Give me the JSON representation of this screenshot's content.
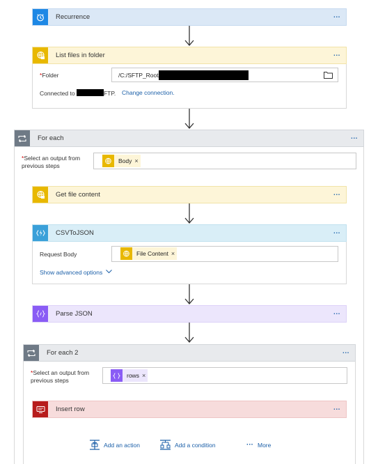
{
  "steps": {
    "recurrence": {
      "title": "Recurrence",
      "icon": "clock-icon",
      "color": "#1e88e5"
    },
    "list_files": {
      "title": "List files in folder",
      "icon": "sftp-icon",
      "color": "#e8b800",
      "folder_label": "Folder",
      "folder_value": "/C:/SFTP_Root/",
      "connected_prefix": "Connected to",
      "connected_suffix": "FTP.",
      "change_connection": "Change connection."
    },
    "for_each": {
      "title": "For each",
      "select_label_line1": "Select an output from",
      "select_label_line2": "previous steps",
      "token": "Body"
    },
    "get_file_content": {
      "title": "Get file content"
    },
    "csv_to_json": {
      "title": "CSVToJSON",
      "icon": "function-icon",
      "color": "#3aa0d9",
      "request_body_label": "Request Body",
      "token": "File Content",
      "advanced": "Show advanced options"
    },
    "parse_json": {
      "title": "Parse JSON",
      "icon": "braces-icon",
      "color": "#8a5cf5"
    },
    "for_each_2": {
      "title": "For each 2",
      "select_label_line1": "Select an output from",
      "select_label_line2": "previous steps",
      "token": "rows"
    },
    "insert_row": {
      "title": "Insert row",
      "icon": "sql-server-icon",
      "color": "#b71c1c"
    }
  },
  "actions": {
    "add_action": "Add an action",
    "add_condition": "Add a condition",
    "more": "More"
  },
  "more_dots": "···",
  "remove_x": "×"
}
